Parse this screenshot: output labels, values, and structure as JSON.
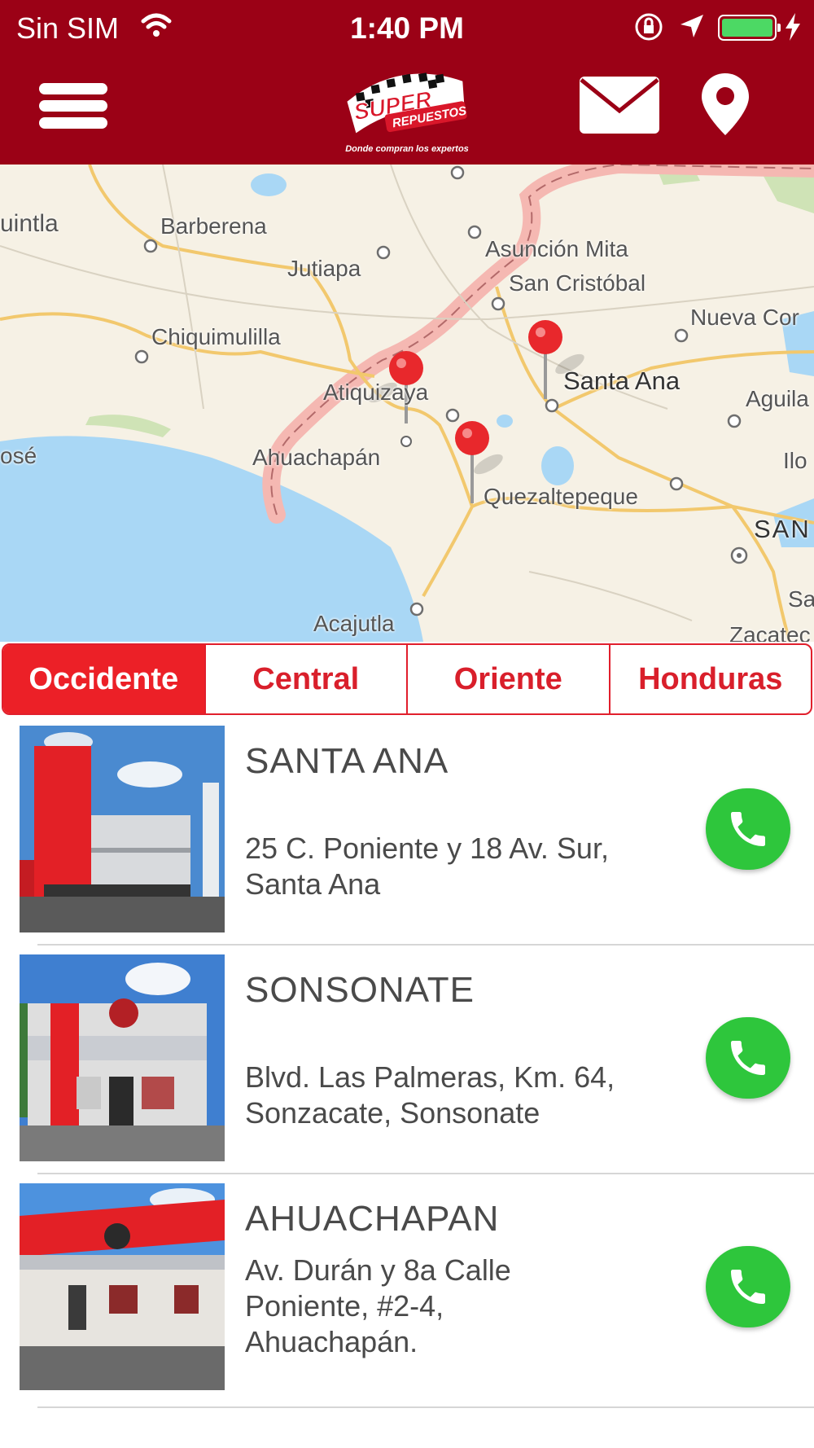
{
  "status_bar": {
    "carrier": "Sin SIM",
    "time": "1:40 PM"
  },
  "header": {
    "logo_text_top": "SUPER",
    "logo_text_bottom": "REPUESTOS",
    "logo_tagline": "Donde compran los expertos"
  },
  "map": {
    "labels": [
      "uintla",
      "Barberena",
      "Jutiapa",
      "Asunción Mita",
      "San Cristóbal",
      "Nueva Cor",
      "Chiquimulilla",
      "Santa Ana",
      "Atiquizaya",
      "Aguila",
      "osé",
      "Ahuachapán",
      "Ilo",
      "Quezaltepeque",
      "SAN",
      "Sa",
      "Acajutla",
      "Zacatec"
    ]
  },
  "segments": [
    "Occidente",
    "Central",
    "Oriente",
    "Honduras"
  ],
  "active_segment": "Occidente",
  "stores": [
    {
      "name": "SANTA ANA",
      "address": [
        "25 C. Poniente y 18 Av. Sur,",
        "Santa Ana"
      ]
    },
    {
      "name": "SONSONATE",
      "address": [
        "Blvd. Las Palmeras, Km. 64,",
        "Sonzacate, Sonsonate"
      ]
    },
    {
      "name": "AHUACHAPAN",
      "address": [
        "Av. Durán y 8a Calle",
        "Poniente, #2-4,",
        "Ahuachapán."
      ]
    }
  ],
  "colors": {
    "header": "#9b0116",
    "accent": "#ec2027",
    "call_green": "#2ec63c"
  },
  "icons": [
    "menu-icon",
    "mail-icon",
    "location-pin-icon",
    "phone-icon",
    "wifi-icon",
    "orientation-lock-icon",
    "location-arrow-icon",
    "battery-icon",
    "charging-bolt-icon"
  ]
}
